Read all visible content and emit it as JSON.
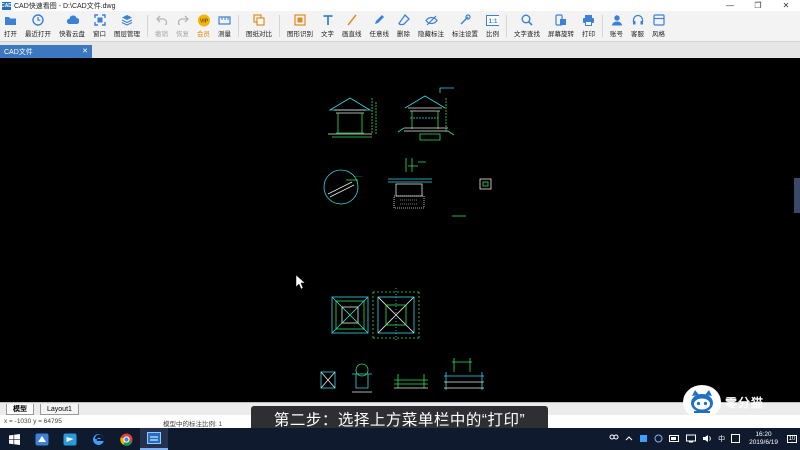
{
  "window": {
    "logo_text": "CAD",
    "title": "CAD快速看图 - D:\\CAD文件.dwg",
    "controls": [
      "—",
      "❐",
      "✕"
    ]
  },
  "toolbar": {
    "open": "打开",
    "recent": "最近打开",
    "cloud": "快看云盘",
    "window": "窗口",
    "layers": "图层管理",
    "undo": "撤销",
    "redo": "恢复",
    "vip": "会员",
    "vip_badge": "VIP",
    "measure": "测量",
    "compare": "图纸对比",
    "recognize": "图形识别",
    "text": "文字",
    "line": "画直线",
    "freeline": "任意线",
    "erase": "删除",
    "hide_mark": "隐藏标注",
    "mark_settings": "标注设置",
    "scale": "比例",
    "scale_badge": "1:1",
    "find_text": "文字查找",
    "rotate_screen": "屏幕旋转",
    "print": "打印",
    "account": "账号",
    "service": "客服",
    "style": "风格"
  },
  "doc_tab": {
    "label": "CAD文件",
    "close": "✕"
  },
  "layout_tabs": {
    "model": "模型",
    "layout1": "Layout1"
  },
  "status": {
    "coords": "x = -1030  y = 64795",
    "scale_text": "模型中的标注比例: 1"
  },
  "subtitle": "第二步：选择上方菜单栏中的“打印”",
  "watermark": {
    "text": "零分猫"
  },
  "taskbar": {
    "clock_time": "16:20",
    "clock_date": "2019/6/19",
    "ime": "中",
    "notif_count": "10"
  },
  "colors": {
    "accent": "#3b78c0",
    "canvas": "#000000",
    "drawing_green": "#2ee35a",
    "drawing_cyan": "#35d6e6",
    "drawing_white": "#e8e8e8"
  }
}
